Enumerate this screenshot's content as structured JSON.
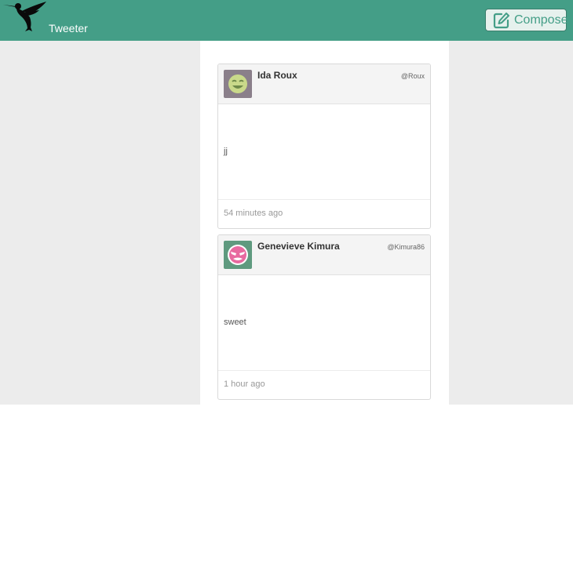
{
  "app": {
    "title": "Tweeter",
    "accent_color": "#449e87",
    "logo_icon": "hummingbird-icon"
  },
  "header": {
    "compose_label": "Compose",
    "compose_icon": "edit-icon"
  },
  "tweets": [
    {
      "name": "Ida Roux",
      "handle": "@Roux",
      "text": "jj",
      "time": "54 minutes ago",
      "avatar_icon": "smiley-face-avatar",
      "avatar_colors": {
        "background": "#8a7f8a",
        "face": "#c9d98a",
        "features": "#6f8a4a"
      }
    },
    {
      "name": "Genevieve Kimura",
      "handle": "@Kimura86",
      "text": "sweet",
      "time": "1 hour ago",
      "avatar_icon": "masked-face-avatar",
      "avatar_colors": {
        "background": "#5f9a7f",
        "face": "#e86aa0",
        "features": "#ffffff"
      }
    }
  ]
}
